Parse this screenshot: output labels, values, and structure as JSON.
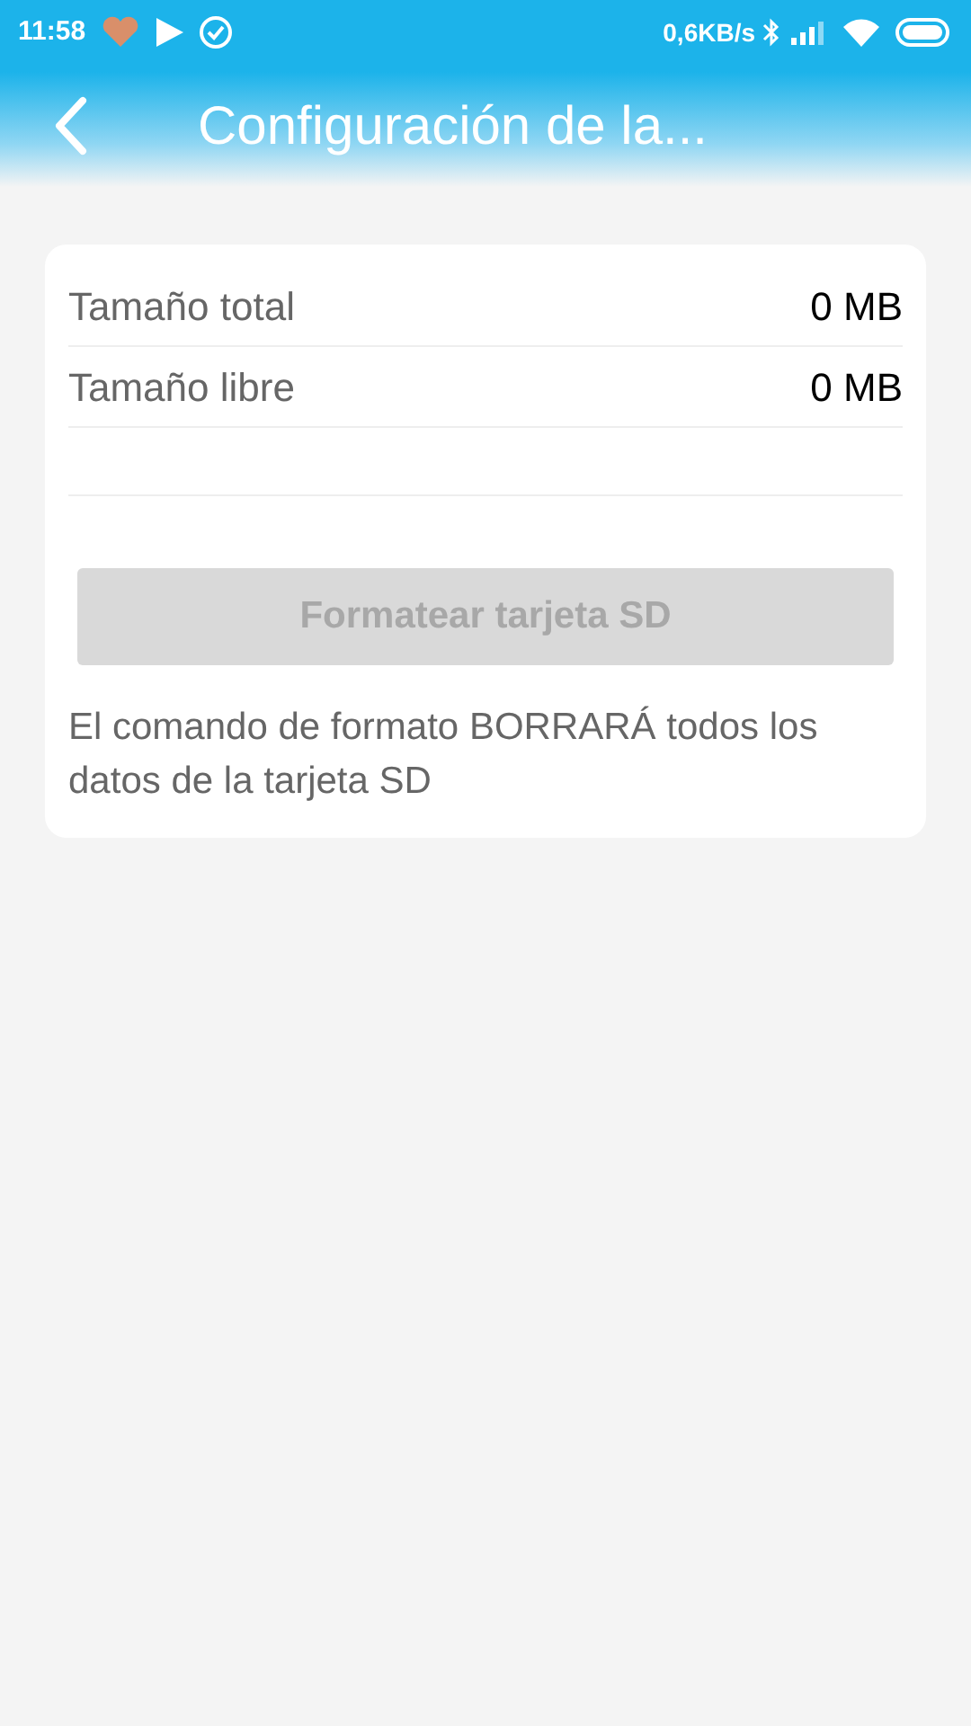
{
  "status_bar": {
    "time": "11:58",
    "speed": "0,6KB/s"
  },
  "header": {
    "title": "Configuración de la..."
  },
  "storage": [
    {
      "label": "Tamaño total",
      "value": "0 MB"
    },
    {
      "label": "Tamaño libre",
      "value": "0 MB"
    }
  ],
  "format_button": {
    "label": "Formatear tarjeta SD",
    "disabled": true
  },
  "note": "El comando de formato BORRARÁ todos los datos de la tarjeta SD"
}
